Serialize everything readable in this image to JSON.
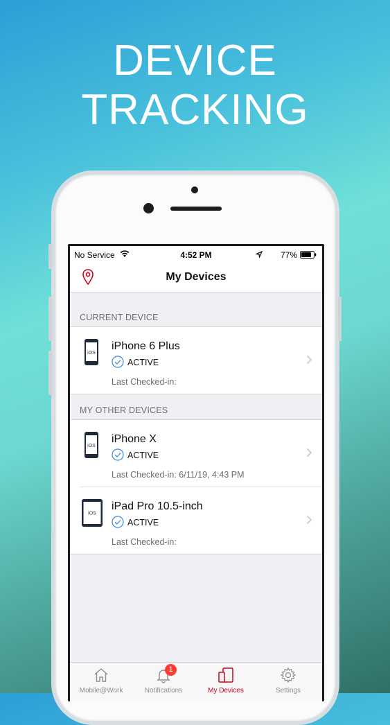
{
  "headline": {
    "line1": "DEVICE",
    "line2": "TRACKING"
  },
  "status_bar": {
    "carrier": "No Service",
    "time": "4:52 PM",
    "battery": "77%"
  },
  "nav": {
    "title": "My Devices",
    "left_icon": "location-pin-icon"
  },
  "sections": {
    "current": {
      "header": "CURRENT DEVICE",
      "devices": [
        {
          "name": "iPhone 6 Plus",
          "os": "iOS",
          "status": "ACTIVE",
          "last_checked": "Last Checked-in:"
        }
      ]
    },
    "other": {
      "header": "MY OTHER DEVICES",
      "devices": [
        {
          "name": "iPhone X",
          "os": "iOS",
          "status": "ACTIVE",
          "last_checked": "Last Checked-in: 6/11/19, 4:43 PM"
        },
        {
          "name": "iPad Pro 10.5-inch",
          "os": "iOS",
          "status": "ACTIVE",
          "last_checked": "Last Checked-in:"
        }
      ]
    }
  },
  "tabs": [
    {
      "label": "Mobile@Work",
      "icon": "home-icon"
    },
    {
      "label": "Notifications",
      "icon": "bell-icon",
      "badge": "1"
    },
    {
      "label": "My Devices",
      "icon": "devices-icon",
      "selected": true
    },
    {
      "label": "Settings",
      "icon": "gear-icon"
    }
  ],
  "colors": {
    "accent": "#d0021b",
    "check": "#3b8bd9",
    "badge": "#ff3b30"
  }
}
